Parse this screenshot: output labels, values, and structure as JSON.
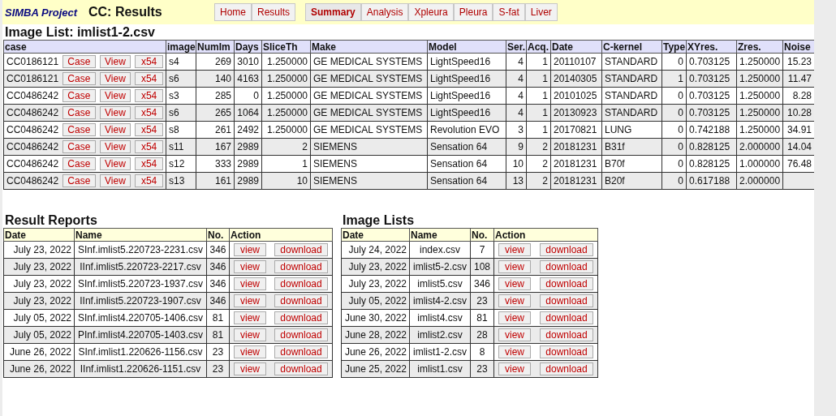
{
  "header": {
    "brand": "SIMBA Project",
    "title": "CC: Results",
    "nav_groups": [
      [
        {
          "label": "Home",
          "selected": false
        },
        {
          "label": "Results",
          "selected": false
        }
      ],
      [
        {
          "label": "Summary",
          "selected": true
        },
        {
          "label": "Analysis",
          "selected": false
        },
        {
          "label": "Xpleura",
          "selected": false
        },
        {
          "label": "Pleura",
          "selected": false
        },
        {
          "label": "S-fat",
          "selected": false
        },
        {
          "label": "Liver",
          "selected": false
        }
      ]
    ]
  },
  "image_list": {
    "title": "Image List: imlist1-2.csv",
    "columns": [
      "case",
      "image",
      "NumIm",
      "Days",
      "SliceTh",
      "Make",
      "Model",
      "Ser.",
      "Acq.",
      "Date",
      "C-kernel",
      "Type",
      "XYres.",
      "Zres.",
      "Noise"
    ],
    "rows": [
      {
        "actions": [
          "Case",
          "View",
          "x54"
        ],
        "cells": [
          "CC0186121",
          "s4",
          "269",
          "3010",
          "1.250000",
          "GE MEDICAL SYSTEMS",
          "LightSpeed16",
          "4",
          "1",
          "20110107",
          "STANDARD",
          "0",
          "0.703125",
          "1.250000",
          "15.23"
        ]
      },
      {
        "actions": [
          "Case",
          "View",
          "x54"
        ],
        "cells": [
          "CC0186121",
          "s6",
          "140",
          "4163",
          "1.250000",
          "GE MEDICAL SYSTEMS",
          "LightSpeed16",
          "4",
          "1",
          "20140305",
          "STANDARD",
          "1",
          "0.703125",
          "1.250000",
          "11.47"
        ]
      },
      {
        "actions": [
          "Case",
          "View",
          "x54"
        ],
        "cells": [
          "CC0486242",
          "s3",
          "285",
          "0",
          "1.250000",
          "GE MEDICAL SYSTEMS",
          "LightSpeed16",
          "4",
          "1",
          "20101025",
          "STANDARD",
          "0",
          "0.703125",
          "1.250000",
          "8.28"
        ]
      },
      {
        "actions": [
          "Case",
          "View",
          "x54"
        ],
        "cells": [
          "CC0486242",
          "s6",
          "265",
          "1064",
          "1.250000",
          "GE MEDICAL SYSTEMS",
          "LightSpeed16",
          "4",
          "1",
          "20130923",
          "STANDARD",
          "0",
          "0.703125",
          "1.250000",
          "10.28"
        ]
      },
      {
        "actions": [
          "Case",
          "View",
          "x54"
        ],
        "cells": [
          "CC0486242",
          "s8",
          "261",
          "2492",
          "1.250000",
          "GE MEDICAL SYSTEMS",
          "Revolution EVO",
          "3",
          "1",
          "20170821",
          "LUNG",
          "0",
          "0.742188",
          "1.250000",
          "34.91"
        ]
      },
      {
        "actions": [
          "Case",
          "View",
          "x54"
        ],
        "cells": [
          "CC0486242",
          "s11",
          "167",
          "2989",
          "2",
          "SIEMENS",
          "Sensation 64",
          "9",
          "2",
          "20181231",
          "B31f",
          "0",
          "0.828125",
          "2.000000",
          "14.04"
        ]
      },
      {
        "actions": [
          "Case",
          "View",
          "x54"
        ],
        "cells": [
          "CC0486242",
          "s12",
          "333",
          "2989",
          "1",
          "SIEMENS",
          "Sensation 64",
          "10",
          "2",
          "20181231",
          "B70f",
          "0",
          "0.828125",
          "1.000000",
          "76.48"
        ]
      },
      {
        "actions": [
          "Case",
          "View",
          "x54"
        ],
        "cells": [
          "CC0486242",
          "s13",
          "161",
          "2989",
          "10",
          "SIEMENS",
          "Sensation 64",
          "13",
          "2",
          "20181231",
          "B20f",
          "0",
          "0.617188",
          "2.000000",
          ""
        ]
      }
    ]
  },
  "result_reports": {
    "title": "Result Reports",
    "columns": [
      "Date",
      "Name",
      "No.",
      "Action"
    ],
    "rows": [
      {
        "date": "July 23, 2022",
        "name": "SInf.imlist5.220723-2231.csv",
        "no": "346",
        "actions": [
          "view",
          "download"
        ]
      },
      {
        "date": "July 23, 2022",
        "name": "IInf.imlist5.220723-2217.csv",
        "no": "346",
        "actions": [
          "view",
          "download"
        ]
      },
      {
        "date": "July 23, 2022",
        "name": "SInf.imlist5.220723-1937.csv",
        "no": "346",
        "actions": [
          "view",
          "download"
        ]
      },
      {
        "date": "July 23, 2022",
        "name": "IInf.imlist5.220723-1907.csv",
        "no": "346",
        "actions": [
          "view",
          "download"
        ]
      },
      {
        "date": "July 05, 2022",
        "name": "SInf.imlist4.220705-1406.csv",
        "no": "81",
        "actions": [
          "view",
          "download"
        ]
      },
      {
        "date": "July 05, 2022",
        "name": "PInf.imlist4.220705-1403.csv",
        "no": "81",
        "actions": [
          "view",
          "download"
        ]
      },
      {
        "date": "June 26, 2022",
        "name": "SInf.imlist1.220626-1156.csv",
        "no": "23",
        "actions": [
          "view",
          "download"
        ]
      },
      {
        "date": "June 26, 2022",
        "name": "IInf.imlist1.220626-1151.csv",
        "no": "23",
        "actions": [
          "view",
          "download"
        ]
      }
    ]
  },
  "image_lists": {
    "title": "Image Lists",
    "columns": [
      "Date",
      "Name",
      "No.",
      "Action"
    ],
    "rows": [
      {
        "date": "July 24, 2022",
        "name": "index.csv",
        "no": "7",
        "actions": [
          "view",
          "download"
        ]
      },
      {
        "date": "July 23, 2022",
        "name": "imlist5-2.csv",
        "no": "108",
        "actions": [
          "view",
          "download"
        ]
      },
      {
        "date": "July 23, 2022",
        "name": "imlist5.csv",
        "no": "346",
        "actions": [
          "view",
          "download"
        ]
      },
      {
        "date": "July 05, 2022",
        "name": "imlist4-2.csv",
        "no": "23",
        "actions": [
          "view",
          "download"
        ]
      },
      {
        "date": "June 30, 2022",
        "name": "imlist4.csv",
        "no": "81",
        "actions": [
          "view",
          "download"
        ]
      },
      {
        "date": "June 28, 2022",
        "name": "imlist2.csv",
        "no": "28",
        "actions": [
          "view",
          "download"
        ]
      },
      {
        "date": "June 26, 2022",
        "name": "imlist1-2.csv",
        "no": "8",
        "actions": [
          "view",
          "download"
        ]
      },
      {
        "date": "June 25, 2022",
        "name": "imlist1.csv",
        "no": "23",
        "actions": [
          "view",
          "download"
        ]
      }
    ]
  }
}
